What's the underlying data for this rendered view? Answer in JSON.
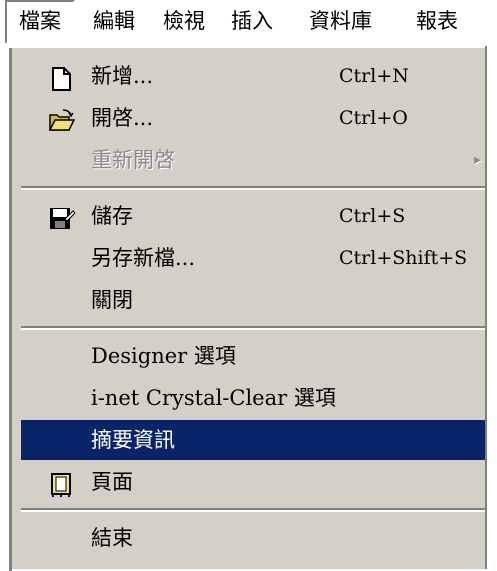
{
  "menubar": {
    "items": [
      {
        "label": "檔案"
      },
      {
        "label": "編輯"
      },
      {
        "label": "檢視"
      },
      {
        "label": "插入"
      },
      {
        "label": "資料庫"
      },
      {
        "label": "報表"
      }
    ]
  },
  "file_menu": {
    "new": {
      "label": "新增...",
      "shortcut": "Ctrl+N",
      "icon": "new-file-icon"
    },
    "open": {
      "label": "開啓...",
      "shortcut": "Ctrl+O",
      "icon": "open-folder-icon"
    },
    "reopen": {
      "label": "重新開啓",
      "submenu_arrow": "▸"
    },
    "save": {
      "label": "儲存",
      "shortcut": "Ctrl+S",
      "icon": "save-disk-icon"
    },
    "save_as": {
      "label": "另存新檔...",
      "shortcut": "Ctrl+Shift+S"
    },
    "close": {
      "label": "關閉"
    },
    "designer_options": {
      "label": "Designer 選項"
    },
    "crystal_clear_options": {
      "label": "i-net Crystal-Clear 選項"
    },
    "summary_info": {
      "label": "摘要資訊"
    },
    "page": {
      "label": "頁面",
      "icon": "page-setup-icon"
    },
    "exit": {
      "label": "結束"
    }
  },
  "colors": {
    "menu_background": "#d4d0c8",
    "selection_background": "#0a246a",
    "selection_text": "#ffffff",
    "disabled_text": "#8a8a8a"
  }
}
